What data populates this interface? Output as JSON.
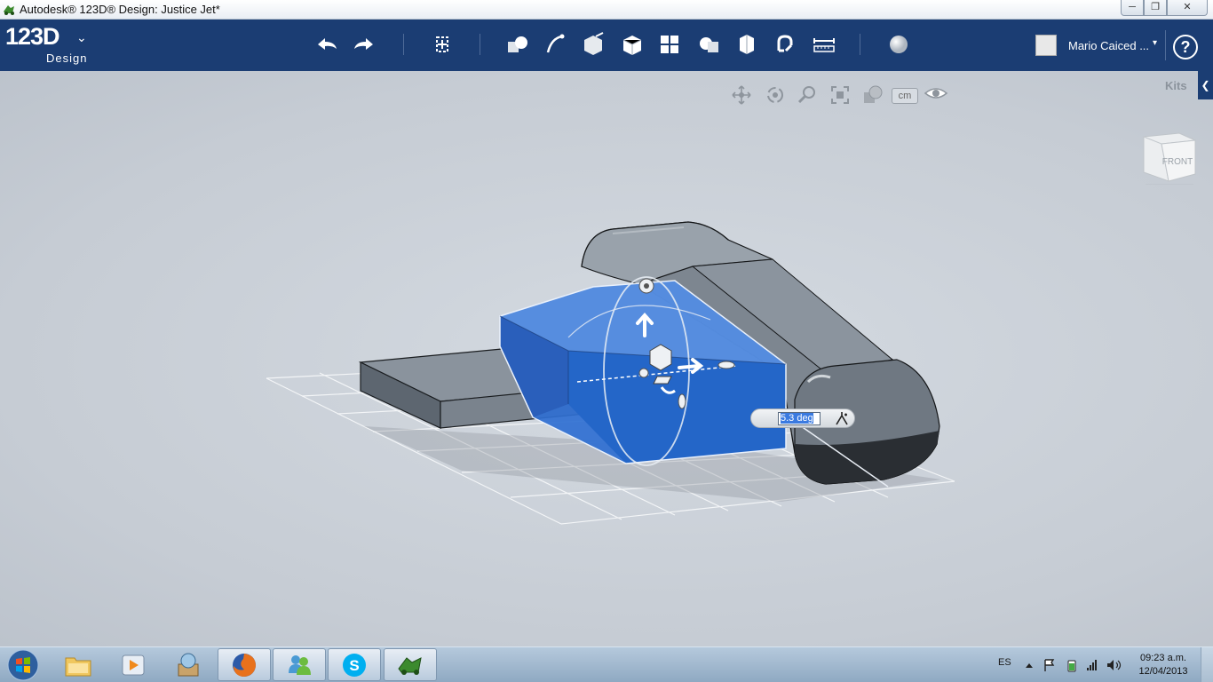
{
  "window": {
    "title": "Autodesk® 123D® Design: Justice Jet*",
    "minimize": "─",
    "maximize": "❐",
    "close": "✕"
  },
  "app": {
    "logo_main": "123D",
    "logo_sub": "Design",
    "logo_chevron": "⌄"
  },
  "toolbar": {
    "tools": [
      {
        "name": "undo-icon"
      },
      {
        "name": "redo-icon"
      },
      {
        "name": "transform-icon"
      },
      {
        "name": "primitives-icon"
      },
      {
        "name": "sketch-icon"
      },
      {
        "name": "construct-icon"
      },
      {
        "name": "modify-icon"
      },
      {
        "name": "pattern-icon"
      },
      {
        "name": "grouping-icon"
      },
      {
        "name": "combine-icon"
      },
      {
        "name": "snap-icon"
      },
      {
        "name": "measure-icon"
      },
      {
        "name": "material-icon"
      }
    ]
  },
  "user": {
    "name": "Mario Caiced ...",
    "caret": "▾"
  },
  "help": {
    "label": "?"
  },
  "viewport": {
    "unit": "cm",
    "kits_label": "Kits",
    "kits_arrow": "❮",
    "viewcube_face": "FRONT",
    "angle_value": "5.3 deg"
  },
  "taskbar": {
    "items": [
      {
        "name": "file-explorer-icon"
      },
      {
        "name": "media-player-icon"
      },
      {
        "name": "archive-app-icon"
      },
      {
        "name": "firefox-icon"
      },
      {
        "name": "messenger-icon"
      },
      {
        "name": "skype-icon"
      },
      {
        "name": "123d-design-icon"
      }
    ],
    "language": "ES",
    "time": "09:23 a.m.",
    "date": "12/04/2013"
  }
}
